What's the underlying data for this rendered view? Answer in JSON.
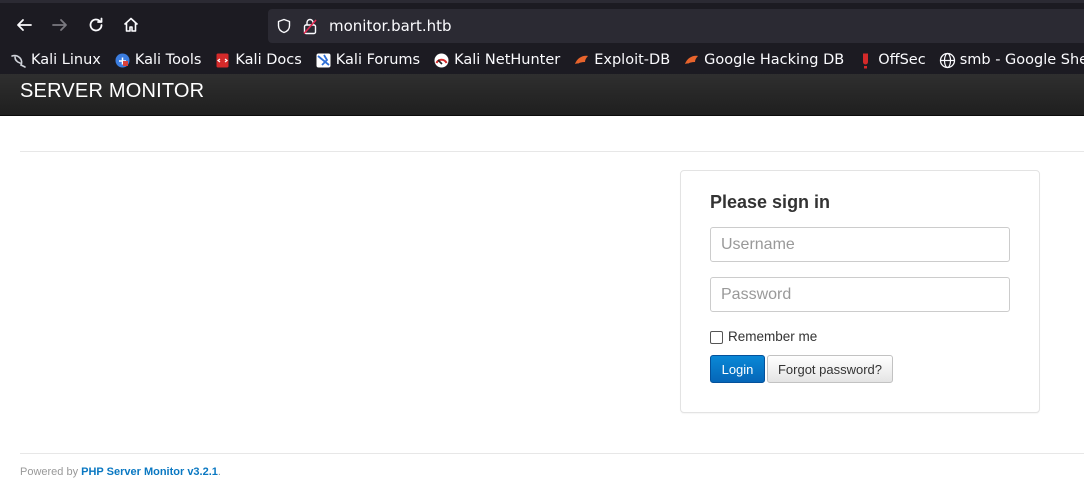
{
  "browser": {
    "url": "monitor.bart.htb",
    "bookmarks": [
      {
        "label": "Kali Linux",
        "icon": "kali-dragon-icon"
      },
      {
        "label": "Kali Tools",
        "icon": "kali-tools-icon"
      },
      {
        "label": "Kali Docs",
        "icon": "kali-docs-icon"
      },
      {
        "label": "Kali Forums",
        "icon": "kali-forums-icon"
      },
      {
        "label": "Kali NetHunter",
        "icon": "nethunter-icon"
      },
      {
        "label": "Exploit-DB",
        "icon": "exploit-db-icon"
      },
      {
        "label": "Google Hacking DB",
        "icon": "ghdb-icon"
      },
      {
        "label": "OffSec",
        "icon": "offsec-icon"
      },
      {
        "label": "smb - Google Sheets",
        "icon": "globe-icon"
      }
    ]
  },
  "navbar": {
    "brand": "SERVER MONITOR"
  },
  "login": {
    "heading": "Please sign in",
    "username_placeholder": "Username",
    "password_placeholder": "Password",
    "remember_label": "Remember me",
    "login_label": "Login",
    "forgot_label": "Forgot password?"
  },
  "footer": {
    "prefix": "Powered by ",
    "link_text": "PHP Server Monitor v3.2.1",
    "suffix": "."
  },
  "colors": {
    "navbar_bg": "#1f1f1f",
    "primary_button": "#0566b8",
    "link": "#0a78c2"
  }
}
